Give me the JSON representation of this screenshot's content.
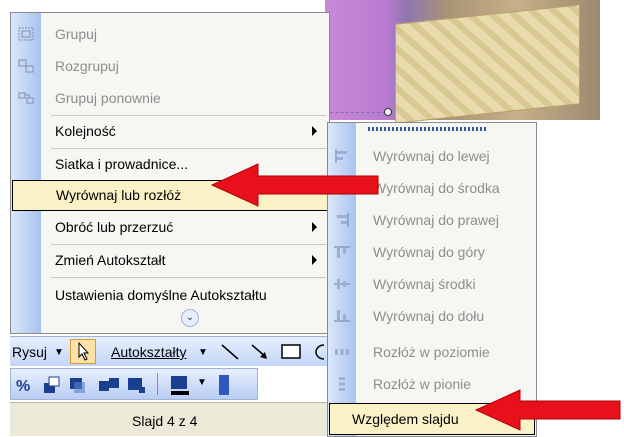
{
  "menu": {
    "items": [
      {
        "label": "Grupuj",
        "disabled": true,
        "icon": "group-icon"
      },
      {
        "label": "Rozgrupuj",
        "disabled": true,
        "icon": "ungroup-icon"
      },
      {
        "label": "Grupuj ponownie",
        "disabled": true,
        "icon": "regroup-icon"
      },
      {
        "label": "Kolejność",
        "submenu": true
      },
      {
        "label": "Siatka i prowadnice..."
      },
      {
        "label": "Wyrównaj lub rozłóż",
        "submenu": true,
        "highlighted": true
      },
      {
        "label": "Obróć lub przerzuć",
        "submenu": true
      },
      {
        "label": "Zmień Autokształt",
        "submenu": true
      },
      {
        "label": "Ustawienia domyślne Autokształtu"
      }
    ],
    "expand_icon": "double-chevron-down-icon"
  },
  "drawing_toolbar": {
    "draw_label": "Rysuj",
    "autoshapes_label": "Autokształty"
  },
  "status_bar": {
    "slide_label": "Slajd 4 z 4"
  },
  "submenu": {
    "items": [
      {
        "label": "Wyrównaj do lewej",
        "icon": "align-left-icon"
      },
      {
        "label": "Wyrównaj do środka",
        "icon": "align-center-icon"
      },
      {
        "label": "Wyrównaj do prawej",
        "icon": "align-right-icon"
      },
      {
        "label": "Wyrównaj do góry",
        "icon": "align-top-icon"
      },
      {
        "label": "Wyrównaj środki",
        "icon": "align-middle-icon"
      },
      {
        "label": "Wyrównaj do dołu",
        "icon": "align-bottom-icon"
      },
      {
        "label": "Rozłóż w poziomie",
        "icon": "distribute-horizontal-icon"
      },
      {
        "label": "Rozłóż w pionie",
        "icon": "distribute-vertical-icon"
      },
      {
        "label": "Względem slajdu",
        "highlighted": true
      }
    ]
  },
  "colors": {
    "arrow": "#e8101a",
    "highlight": "#fbf1c7",
    "gutter": "#a9c3ee"
  }
}
